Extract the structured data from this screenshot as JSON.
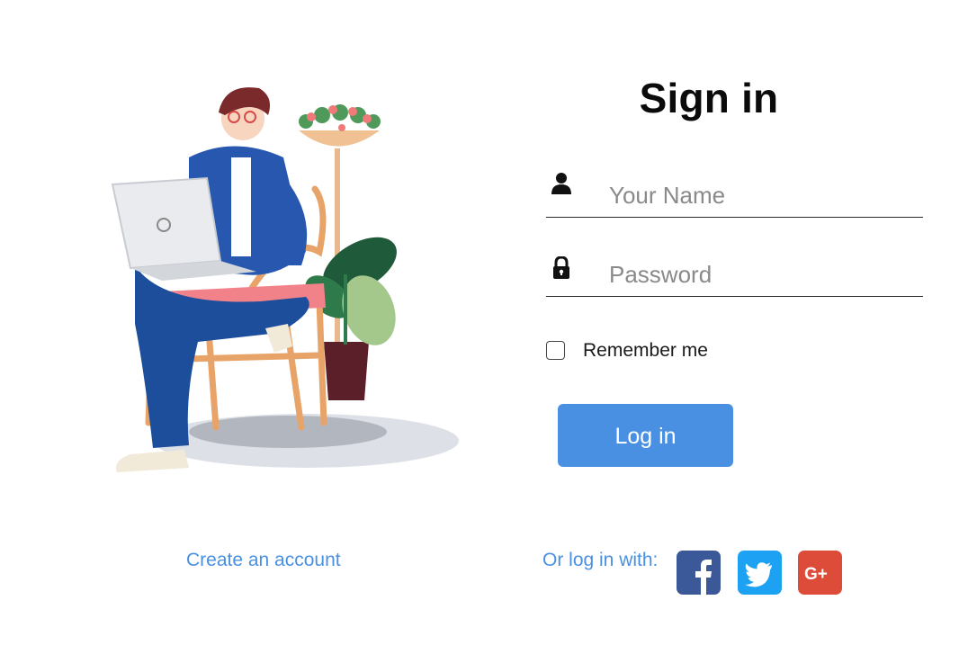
{
  "header": {
    "title": "Sign in"
  },
  "form": {
    "name_placeholder": "Your Name",
    "name_value": "",
    "password_placeholder": "Password",
    "password_value": "",
    "remember_label": "Remember me",
    "remember_checked": false,
    "login_label": "Log in"
  },
  "footer": {
    "create_account": "Create an account",
    "social_label": "Or log in with:",
    "social": [
      {
        "icon": "facebook-icon",
        "color": "#3b5998"
      },
      {
        "icon": "twitter-icon",
        "color": "#1da1f2"
      },
      {
        "icon": "google-plus-icon",
        "color": "#dd4b39"
      }
    ]
  },
  "colors": {
    "accent": "#4a90e2",
    "text": "#111111"
  },
  "icons": {
    "name_field": "person-icon",
    "password_field": "lock-icon"
  }
}
